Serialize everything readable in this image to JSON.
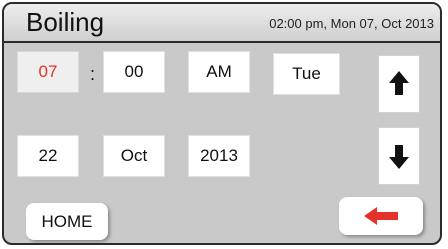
{
  "header": {
    "title": "Boiling",
    "datetime": "02:00 pm, Mon 07, Oct 2013"
  },
  "time": {
    "hour": "07",
    "separator": ":",
    "minute": "00",
    "ampm": "AM",
    "weekday": "Tue"
  },
  "date": {
    "day": "22",
    "month": "Oct",
    "year": "2013"
  },
  "buttons": {
    "home_label": "HOME",
    "up_icon": "arrow-up-icon",
    "down_icon": "arrow-down-icon",
    "back_icon": "arrow-left-icon"
  },
  "colors": {
    "selected_text": "#e4322b",
    "back_arrow": "#e4322b",
    "panel_bg": "#c9c9c9"
  }
}
